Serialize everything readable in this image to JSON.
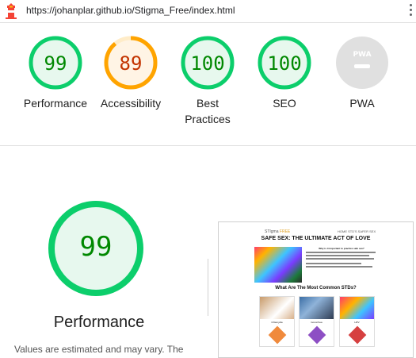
{
  "address_bar": {
    "url": "https://johanplar.github.io/Stigma_Free/index.html"
  },
  "gauges": [
    {
      "label": "Performance",
      "score": "99",
      "status": "pass"
    },
    {
      "label": "Accessibility",
      "score": "89",
      "status": "average"
    },
    {
      "label": "Best\nPractices",
      "score": "100",
      "status": "pass"
    },
    {
      "label": "SEO",
      "score": "100",
      "status": "pass"
    },
    {
      "label": "PWA",
      "score": "",
      "status": "na",
      "badge": "PWA"
    }
  ],
  "main": {
    "score": "99",
    "title": "Performance",
    "note": "Values are estimated and may vary. The"
  },
  "screenshot": {
    "brand_prefix": "STIgma",
    "brand_suffix": "FREE",
    "nav": "HOME    STD'S    SAFER SEX",
    "headline": "SAFE SEX: THE ULTIMATE ACT OF LOVE",
    "hero_question": "Why is it important to practice safe sex?",
    "section_title": "What Are The Most Common STDs?",
    "cards": [
      "Chlamydia",
      "Gonorrhea",
      "HPV"
    ]
  },
  "colors": {
    "pass": "#0cce6b",
    "pass_text": "#008800",
    "average": "#ffa400",
    "average_text": "#c33300",
    "na": "#e0e0e0"
  }
}
